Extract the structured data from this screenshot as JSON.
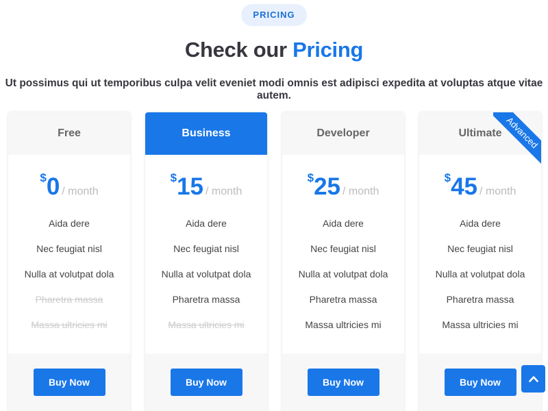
{
  "section": {
    "badge": "PRICING",
    "title_prefix": "Check our",
    "title_accent": "Pricing",
    "subtitle": "Ut possimus qui ut temporibus culpa velit eveniet modi omnis est adipisci expedita at voluptas atque vitae autem."
  },
  "colors": {
    "accent": "#1977e8",
    "badge_bg": "#e8f0fe",
    "title": "#37373f",
    "muted": "#cccccc"
  },
  "plans": [
    {
      "name": "Free",
      "currency": "$",
      "amount": "0",
      "period": "/ month",
      "featured": false,
      "features": [
        {
          "text": "Aida dere",
          "available": true
        },
        {
          "text": "Nec feugiat nisl",
          "available": true
        },
        {
          "text": "Nulla at volutpat dola",
          "available": true
        },
        {
          "text": "Pharetra massa",
          "available": false
        },
        {
          "text": "Massa ultricies mi",
          "available": false
        }
      ],
      "button": "Buy Now"
    },
    {
      "name": "Business",
      "currency": "$",
      "amount": "15",
      "period": "/ month",
      "featured": true,
      "features": [
        {
          "text": "Aida dere",
          "available": true
        },
        {
          "text": "Nec feugiat nisl",
          "available": true
        },
        {
          "text": "Nulla at volutpat dola",
          "available": true
        },
        {
          "text": "Pharetra massa",
          "available": true
        },
        {
          "text": "Massa ultricies mi",
          "available": false
        }
      ],
      "button": "Buy Now"
    },
    {
      "name": "Developer",
      "currency": "$",
      "amount": "25",
      "period": "/ month",
      "featured": false,
      "features": [
        {
          "text": "Aida dere",
          "available": true
        },
        {
          "text": "Nec feugiat nisl",
          "available": true
        },
        {
          "text": "Nulla at volutpat dola",
          "available": true
        },
        {
          "text": "Pharetra massa",
          "available": true
        },
        {
          "text": "Massa ultricies mi",
          "available": true
        }
      ],
      "button": "Buy Now"
    },
    {
      "name": "Ultimate",
      "currency": "$",
      "amount": "45",
      "period": "/ month",
      "featured": false,
      "ribbon": "Advanced",
      "features": [
        {
          "text": "Aida dere",
          "available": true
        },
        {
          "text": "Nec feugiat nisl",
          "available": true
        },
        {
          "text": "Nulla at volutpat dola",
          "available": true
        },
        {
          "text": "Pharetra massa",
          "available": true
        },
        {
          "text": "Massa ultricies mi",
          "available": true
        }
      ],
      "button": "Buy Now"
    }
  ],
  "back_to_top": {
    "icon": "chevron-up-icon"
  }
}
